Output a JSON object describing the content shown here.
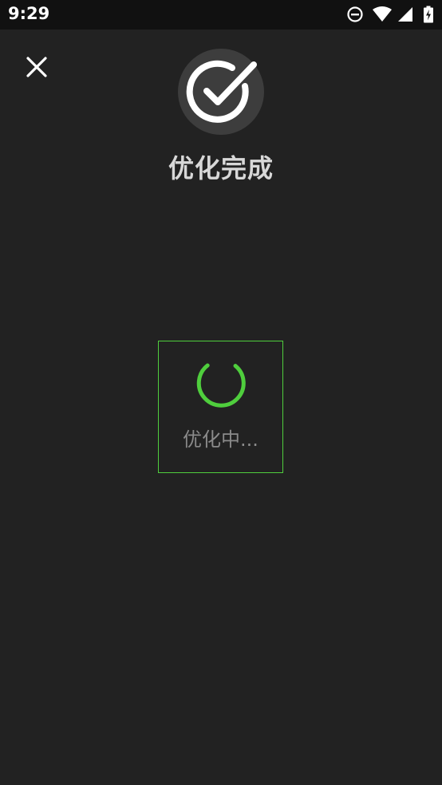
{
  "status_bar": {
    "time": "9:29",
    "icons": [
      "do-not-disturb-icon",
      "wifi-icon",
      "cell-signal-icon",
      "battery-charging-icon"
    ]
  },
  "close_icon": "close-icon",
  "result": {
    "icon": "check-circle-icon",
    "title": "优化完成"
  },
  "loading": {
    "text": "优化中...",
    "icon": "spinner-icon",
    "accent_color": "#4fce3d"
  },
  "colors": {
    "background": "#222222",
    "status_bar": "#111111",
    "accent": "#4fce3d"
  }
}
